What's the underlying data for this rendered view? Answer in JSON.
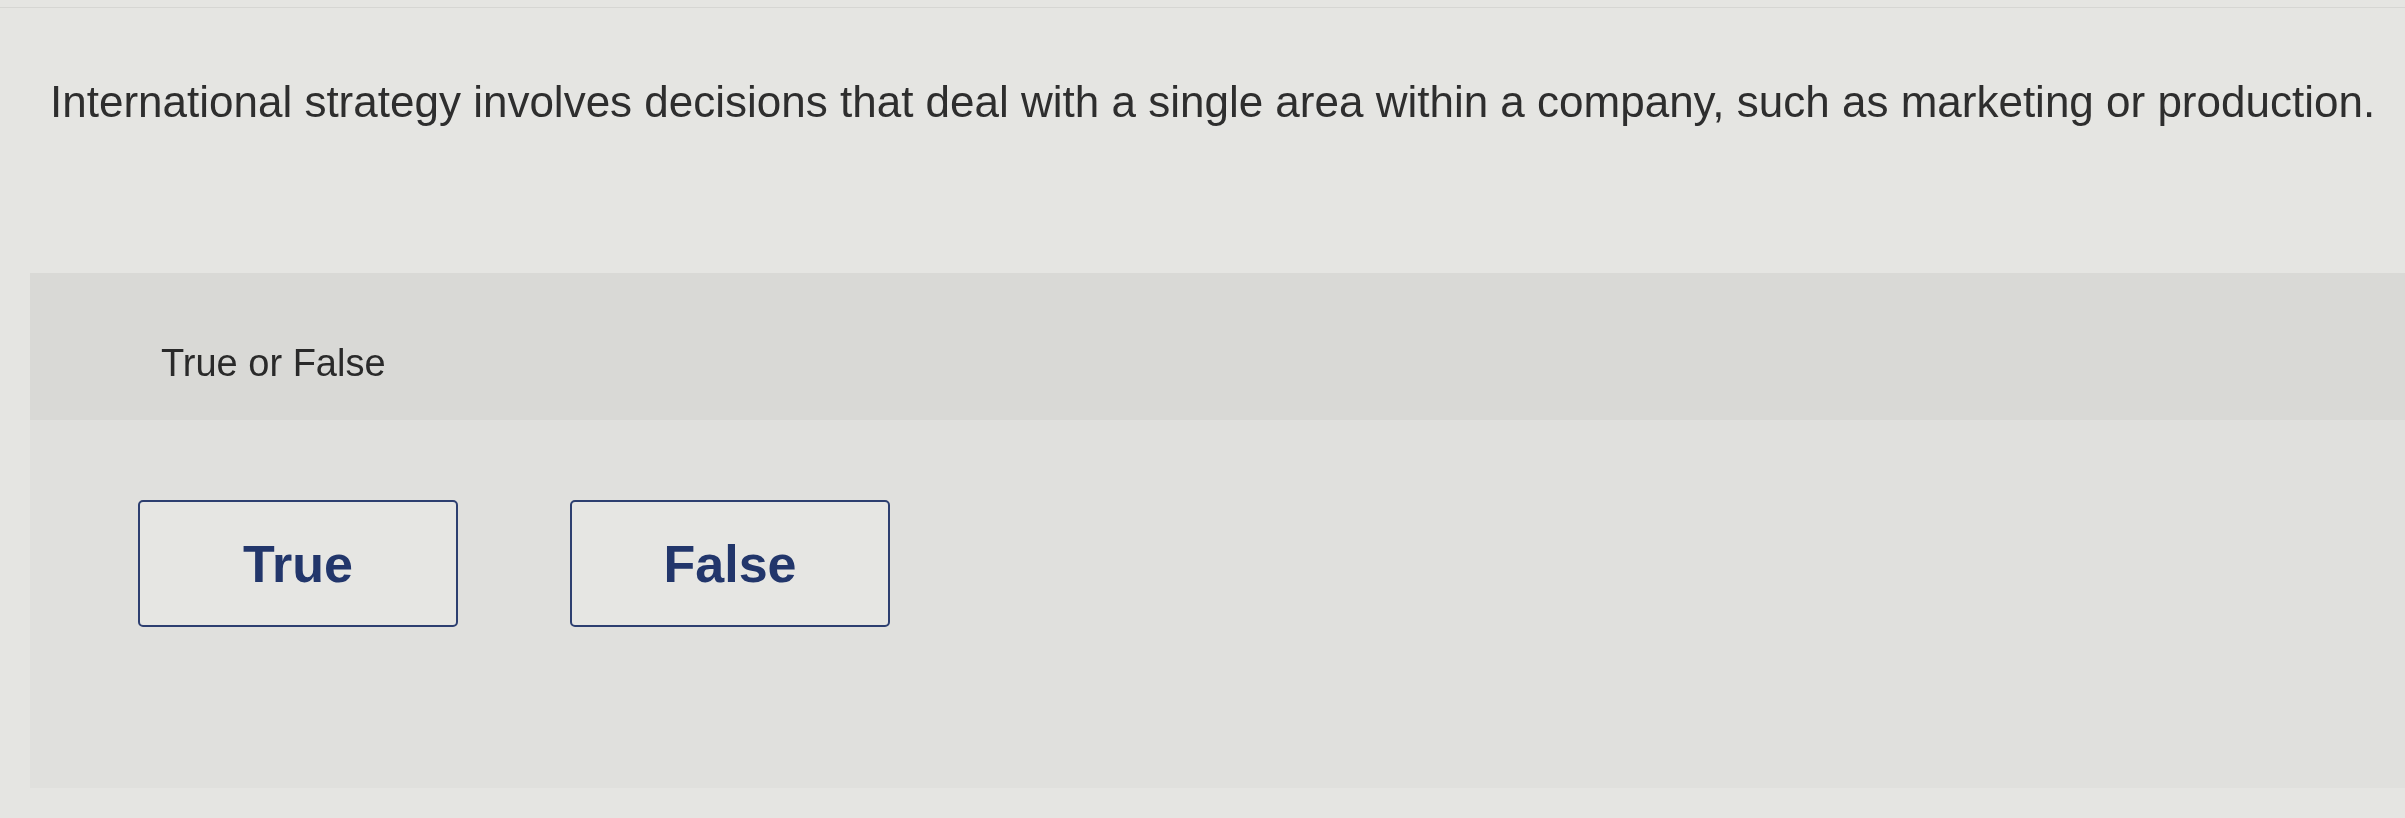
{
  "question": {
    "text": "International strategy involves decisions that deal with a single area within a company, such as marketing or production."
  },
  "answer_panel": {
    "prompt": "True or False",
    "options": [
      {
        "label": "True",
        "selected": false
      },
      {
        "label": "False",
        "selected": false
      }
    ]
  }
}
